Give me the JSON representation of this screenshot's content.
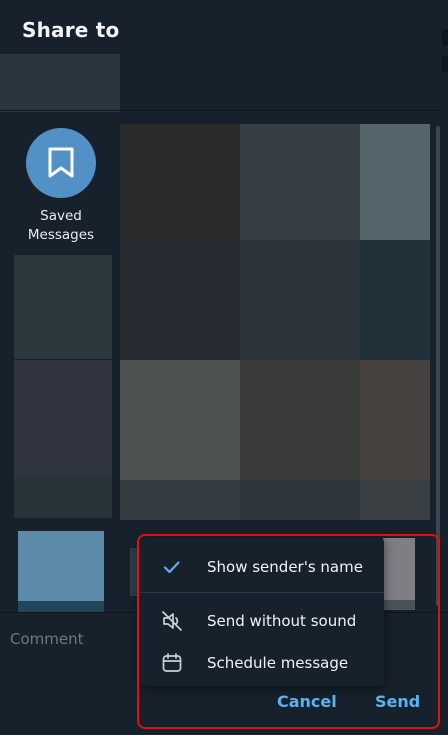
{
  "dialog": {
    "title": "Share to"
  },
  "saved_messages": {
    "label_line1": "Saved",
    "label_line2": "Messages",
    "avatar_color": "#5291c5"
  },
  "comment": {
    "placeholder": "Comment"
  },
  "menu": {
    "items": [
      {
        "label": "Show sender's name",
        "icon": "check-icon",
        "checked": true
      },
      {
        "label": "Send without sound",
        "icon": "muted-speaker-icon"
      },
      {
        "label": "Schedule message",
        "icon": "calendar-icon"
      }
    ]
  },
  "actions": {
    "cancel_label": "Cancel",
    "send_label": "Send"
  },
  "colors": {
    "accent": "#5ab3f0",
    "background": "#17212b",
    "highlight": "#e01010"
  }
}
